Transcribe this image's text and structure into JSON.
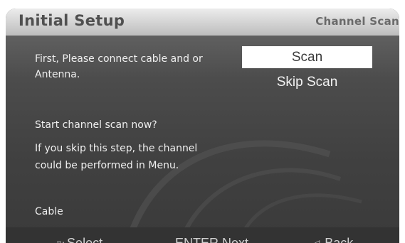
{
  "header": {
    "title": "Initial Setup",
    "section": "Channel Scan"
  },
  "content": {
    "instruction_lines": [
      "First, Please connect cable and or",
      "Antenna."
    ],
    "scan_prompt": "Start  channel scan now?",
    "skip_note_lines": [
      "If you skip this step, the channel",
      "could be performed in Menu."
    ],
    "signal_source": "Cable"
  },
  "options": [
    {
      "label": "Scan",
      "selected": true
    },
    {
      "label": "Skip Scan",
      "selected": false
    }
  ],
  "footer": {
    "select": {
      "icon": "up-down-arrows-icon",
      "label": "Select"
    },
    "enter": {
      "key": "ENTER",
      "label": "Next"
    },
    "back": {
      "icon": "left-arrow-icon",
      "label": "Back"
    }
  }
}
